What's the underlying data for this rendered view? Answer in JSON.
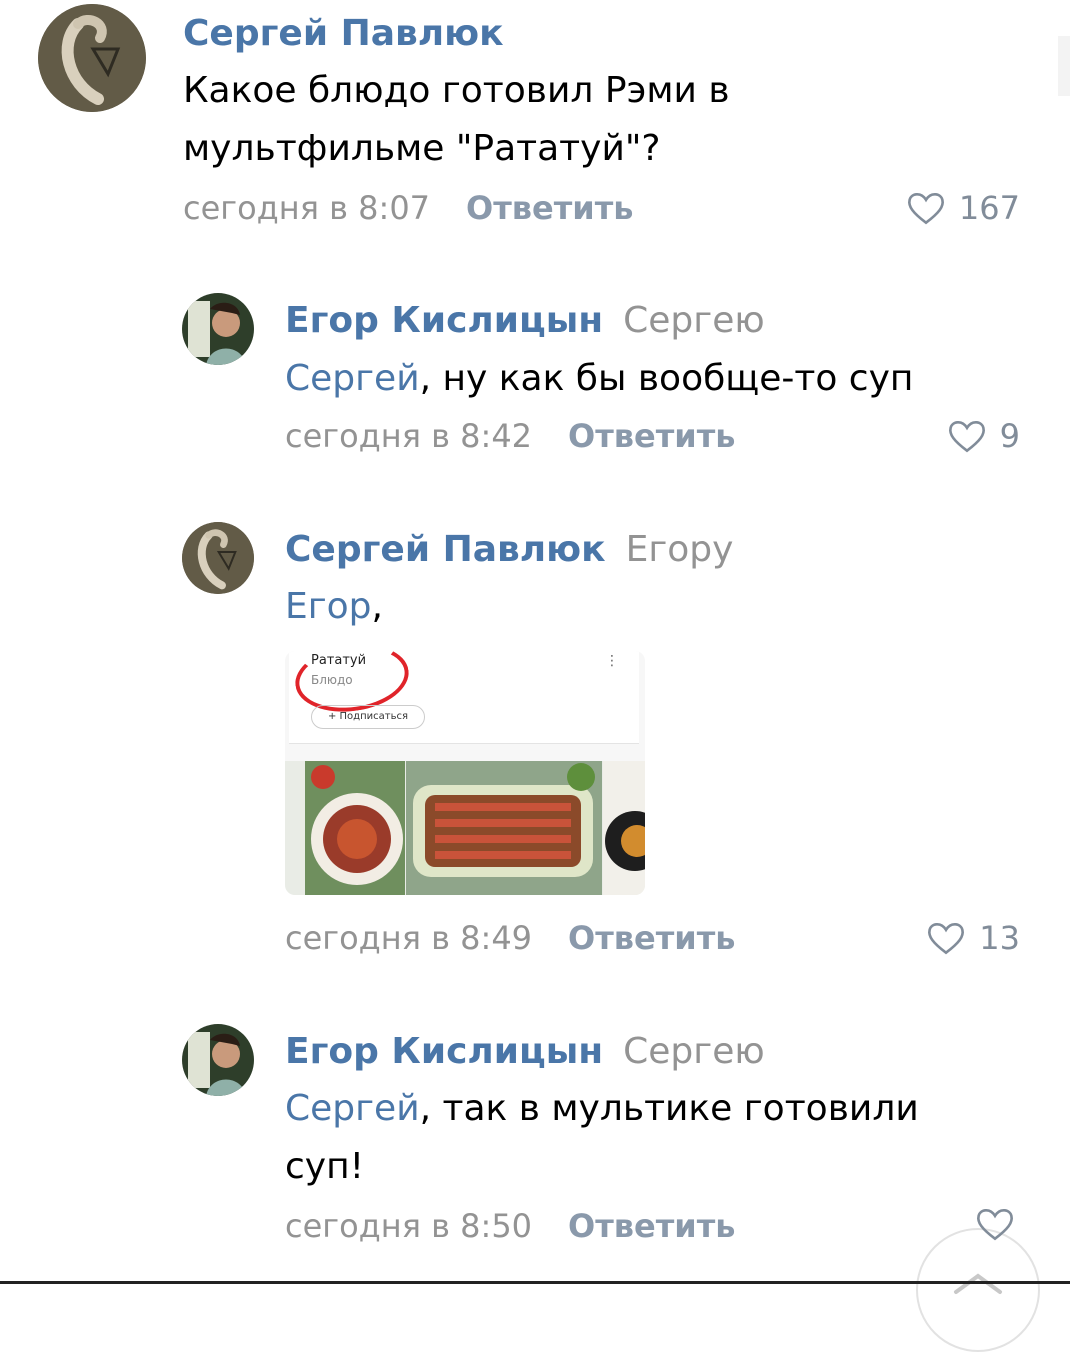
{
  "comments": [
    {
      "author": "Сергей Павлюк",
      "reply_to": "",
      "mention": "",
      "text_lines": [
        "Какое блюдо готовил Рэми в",
        "мультфильме \"Рататуй\"?"
      ],
      "time": "сегодня в 8:07",
      "reply_label": "Ответить",
      "likes": "167",
      "avatar_icon": "snake-avatar-icon"
    },
    {
      "author": "Егор Кислицын",
      "reply_to": "Сергею",
      "mention": "Сергей",
      "text_lines": [
        ", ну как бы вообще-то суп"
      ],
      "time": "сегодня в 8:42",
      "reply_label": "Ответить",
      "likes": "9",
      "avatar_icon": "person-avatar-icon"
    },
    {
      "author": "Сергей Павлюк",
      "reply_to": "Егору",
      "mention": "Егор",
      "text_lines": [
        ","
      ],
      "attachment": {
        "title": "Рататуй",
        "subtitle": "Блюдо",
        "subscribe": "+ Подписаться",
        "menu": "⋮"
      },
      "time": "сегодня в 8:49",
      "reply_label": "Ответить",
      "likes": "13",
      "avatar_icon": "snake-avatar-icon"
    },
    {
      "author": "Егор Кислицын",
      "reply_to": "Сергею",
      "mention": "Сергей",
      "text_lines": [
        ", так в мультике готовили",
        "суп!"
      ],
      "time": "сегодня в 8:50",
      "reply_label": "Ответить",
      "likes": "",
      "avatar_icon": "person-avatar-icon"
    }
  ],
  "colors": {
    "link": "#4a76a8",
    "secondary": "#939393",
    "action": "#8a99ab"
  }
}
